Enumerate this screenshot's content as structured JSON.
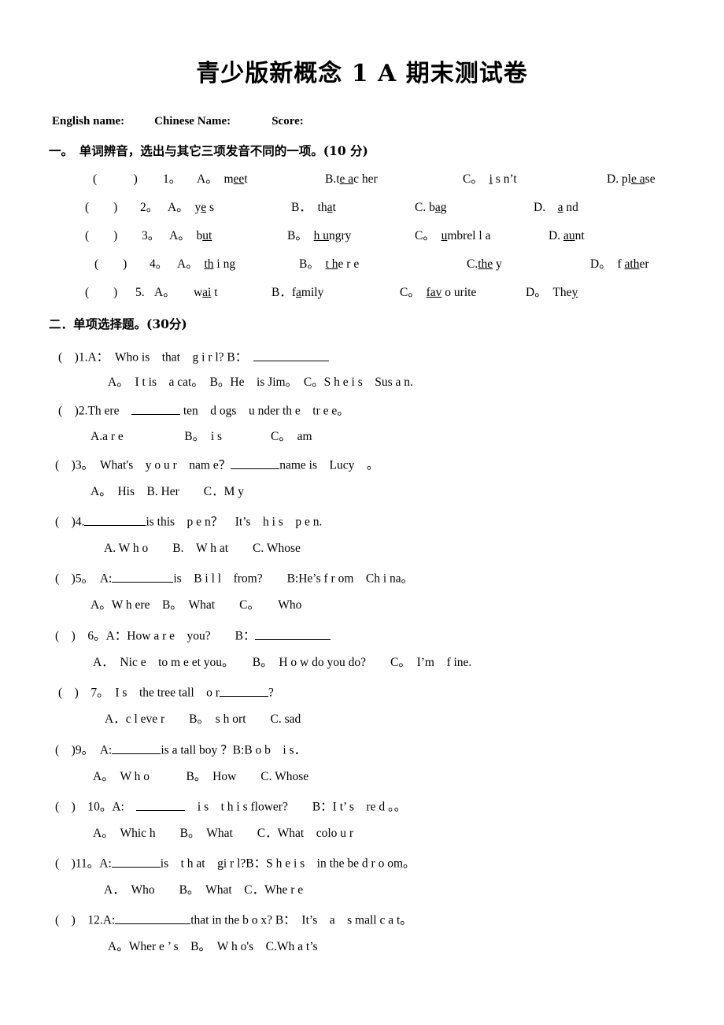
{
  "document": {
    "title": "青少版新概念 1 A 期末测试卷",
    "header": {
      "english_name_label": "English name:",
      "chinese_name_label": "Chinese Name:",
      "score_label": "Score:"
    }
  },
  "section_one": {
    "heading": "一。　单词辨音，选出与其它三项发音不同的一项。(10 分)",
    "questions": [
      {
        "bracket": "(　　　)",
        "number": "1。",
        "options": [
          {
            "letter": "A。",
            "pre": "m",
            "mark": "ee",
            "post": "t"
          },
          {
            "letter": "B.",
            "pre": "t",
            "mark": "e a",
            "post": "c her"
          },
          {
            "letter": "C。",
            "pre": "",
            "mark": "i",
            "post": " s n’t"
          },
          {
            "letter": "D.",
            "pre": "pl",
            "mark": "e a",
            "post": "se"
          }
        ]
      },
      {
        "bracket": "(　　)",
        "number": "2。",
        "options": [
          {
            "letter": "A。",
            "pre": "y",
            "mark": "e",
            "post": " s"
          },
          {
            "letter": "B．",
            "pre": "th",
            "mark": "a",
            "post": "t"
          },
          {
            "letter": "C.",
            "pre": "b",
            "mark": "a",
            "post": "g"
          },
          {
            "letter": "D.",
            "pre": "",
            "mark": "a",
            "post": " nd"
          }
        ]
      },
      {
        "bracket": "(　　)",
        "number": "3。",
        "options": [
          {
            "letter": "A。",
            "pre": "b",
            "mark": "ut",
            "post": ""
          },
          {
            "letter": "B。",
            "pre": "",
            "mark": "h u",
            "post": "ngry"
          },
          {
            "letter": "C。",
            "pre": "",
            "mark": "u",
            "post": "mbrel l a"
          },
          {
            "letter": "D.",
            "pre": "",
            "mark": "au",
            "post": "nt"
          }
        ]
      },
      {
        "bracket": "(　　)",
        "number": "4。",
        "options": [
          {
            "letter": "A。",
            "pre": "",
            "mark": "th",
            "post": " i ng"
          },
          {
            "letter": "B。",
            "pre": "",
            "mark": "t h",
            "post": "e r e"
          },
          {
            "letter": "C.",
            "pre": "",
            "mark": "the",
            "post": " y"
          },
          {
            "letter": "D。",
            "pre": "f ",
            "mark": "ath",
            "post": "er"
          }
        ]
      },
      {
        "bracket": "(　　)",
        "number": "5.",
        "options": [
          {
            "letter": "A。",
            "pre": "w",
            "mark": "ai",
            "post": " t"
          },
          {
            "letter": "B．",
            "pre": "f",
            "mark": "a",
            "post": "mily"
          },
          {
            "letter": "C。",
            "pre": "",
            "mark": "fav",
            "post": " o urite"
          },
          {
            "letter": "D。",
            "pre": "The",
            "mark": "y",
            "post": ""
          }
        ]
      }
    ]
  },
  "section_two": {
    "heading": "二．单项选择题。(30分)",
    "questions": [
      {
        "bracket": "(　)",
        "number": "1.",
        "stem": "A：　Who is　that　g i r l? B：",
        "options": "A。　I t is　a cat。　B。He　is Jim。　C。S h e i s　Sus a n."
      },
      {
        "bracket": "(　)",
        "number": "2.",
        "stem": "Th ere",
        "stem_tail": "ten　d ogs　u nder th e　tr e e。",
        "options": "A.a r e　　　　　B。　i s　　　　C。　am"
      },
      {
        "bracket": "(　)",
        "number": "3。",
        "stem": "What's　y o u r　nam e？",
        "stem_tail": "name is　Lucy　。",
        "options": "A。　His　B. Her　　C．M y"
      },
      {
        "bracket": "(　)",
        "number": "4.",
        "stem": "",
        "stem_tail": "is this　p e n？　It’s　h i s　p e n.",
        "options": "A. W h o　　B.　W h at　　C. Whose"
      },
      {
        "bracket": "(　)",
        "number": "5。",
        "stem": "A:",
        "stem_tail": "is　B i l l　from?　　B:He’s f r om　Ch i na。",
        "options": "A。W h ere　B。　What　　C。　　Who"
      },
      {
        "bracket": "(　)",
        "number": "6。",
        "stem": "A：How a r e　you?　　B：",
        "options": "A．　Nic e　to m e et you。　　B。　H o w do you do?　　C。　I’m　f ine."
      },
      {
        "bracket": "(　)",
        "number": "7。",
        "stem": "I s　the tree tall　o r",
        "stem_tail": "?",
        "options": "A．c l eve r　　B。　s h ort　　C. sad"
      },
      {
        "bracket": "(　)",
        "number": "9。",
        "stem": "A:",
        "stem_tail": "is a tall boy ？B:B o b　i s．",
        "options": "A。　W h o　　　B。　How　　C. Whose"
      },
      {
        "bracket": "(　)",
        "number": "10。",
        "stem": "A:",
        "stem_tail": "i s　t h i s flower?　　B：I t’ s　re d 。。",
        "options": "A。　Whic h　　B。　What　　C．What　colo u r"
      },
      {
        "bracket": "(　)",
        "number": "11。",
        "stem": "A:",
        "stem_tail": "is　t h at　gi r l?B：S h e i s　in the be d r o om。",
        "options": "A．　Who　　B。　What　C．Whe r e"
      },
      {
        "bracket": "(　)",
        "number": "12.",
        "stem": "A:",
        "stem_tail": "that in the b o x? B：　It’s　a　s mall c a t。",
        "options": "A。Wher e ’ s　B。　W h o's　C.Wh a t’s"
      }
    ]
  }
}
